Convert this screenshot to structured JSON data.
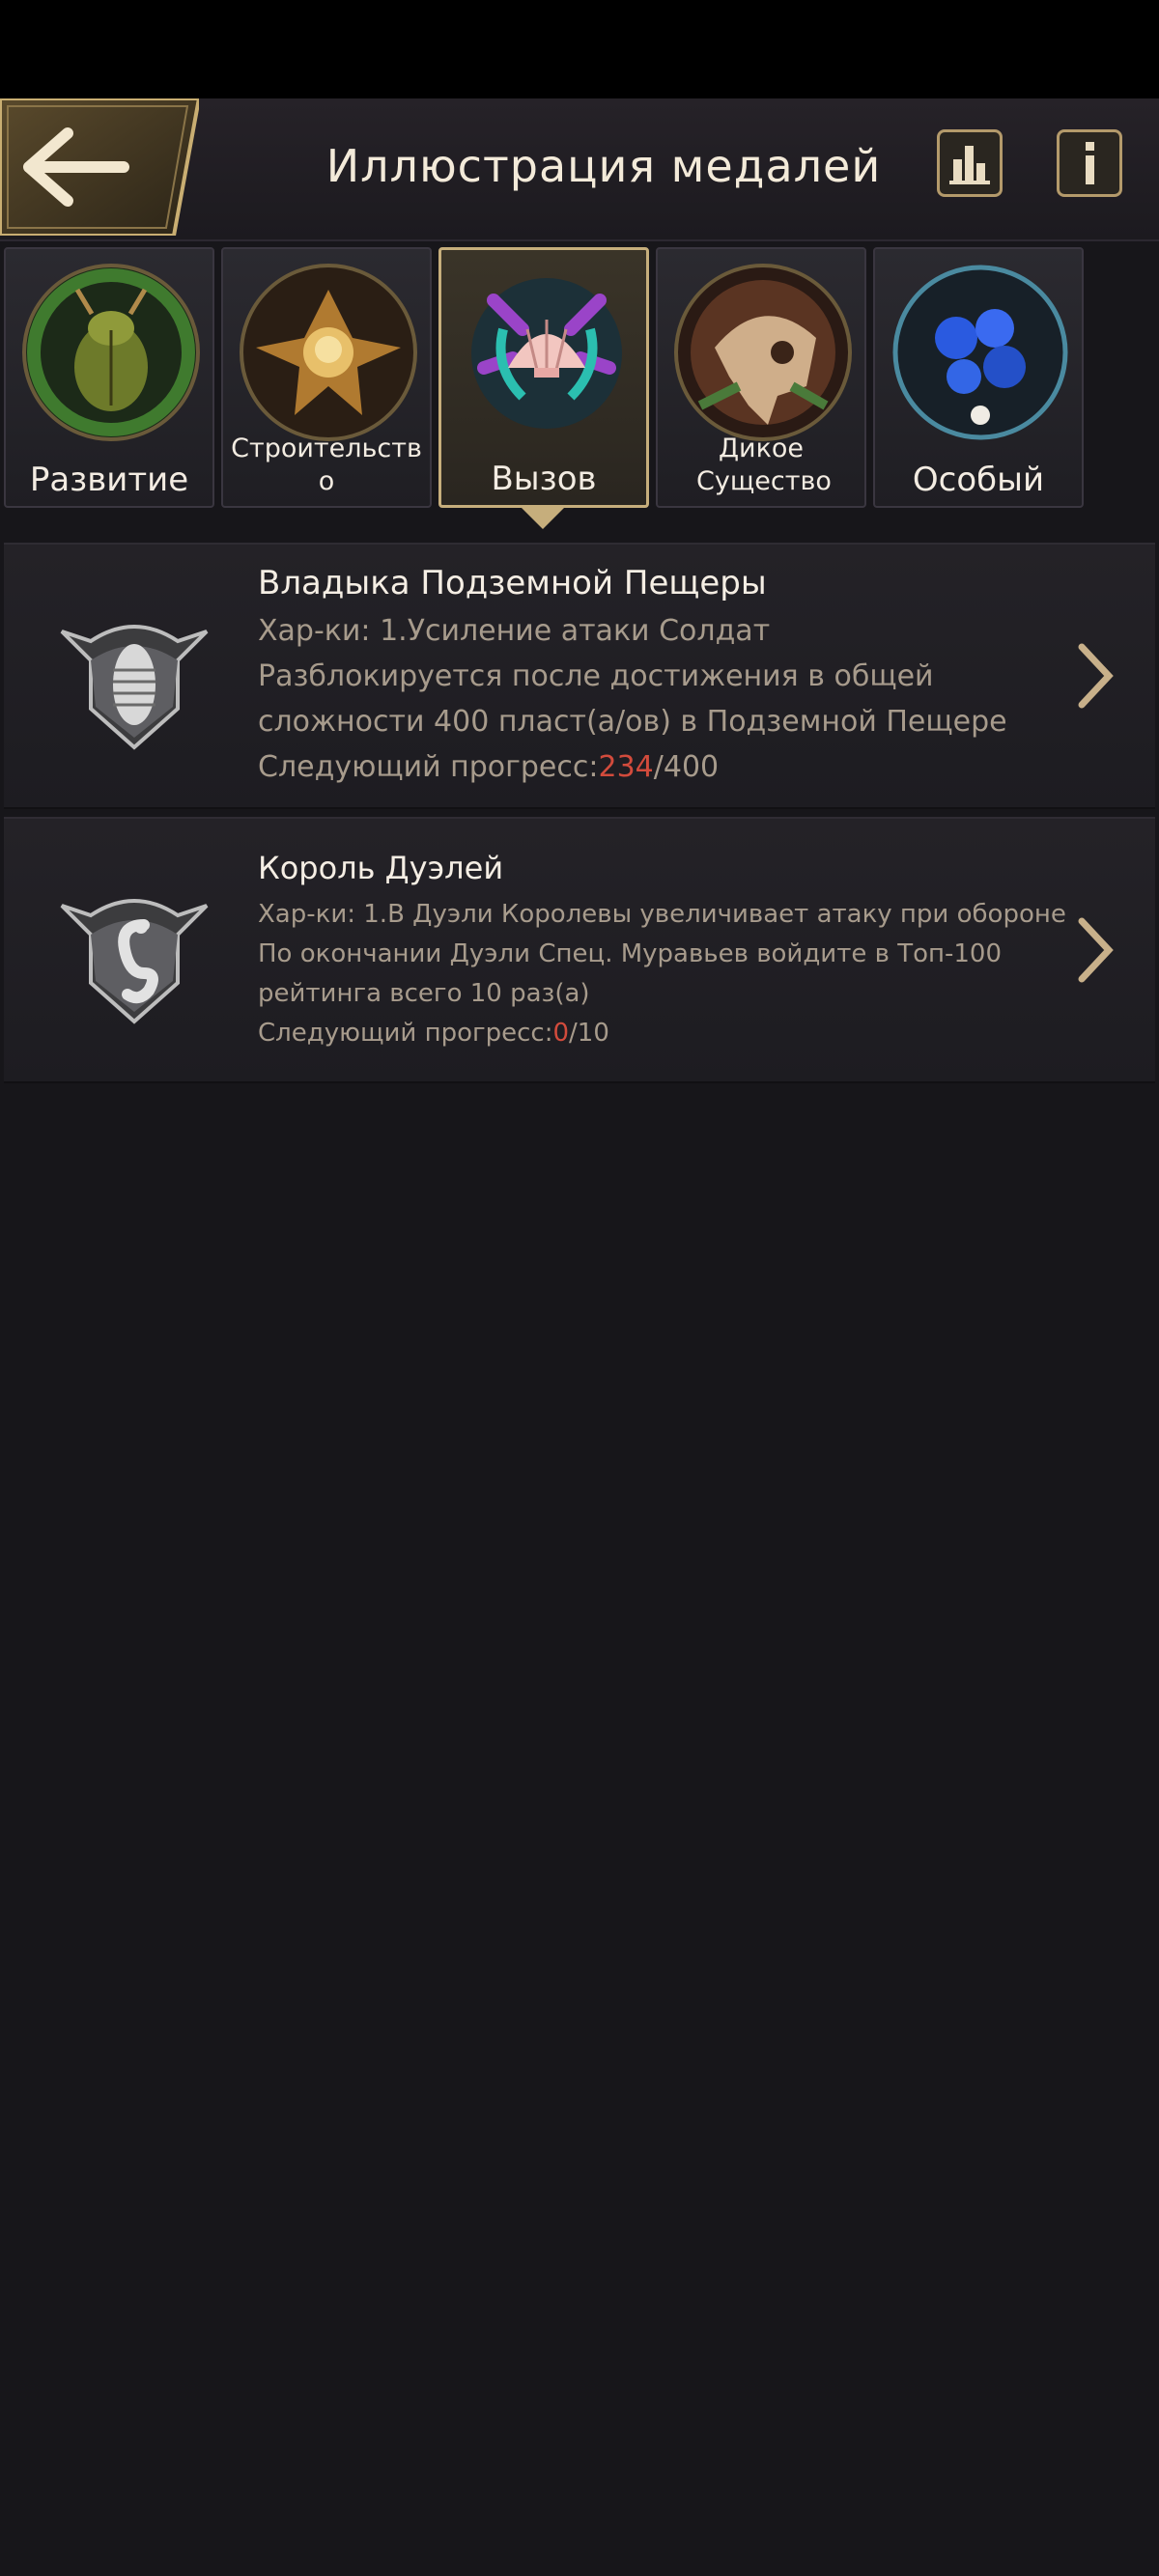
{
  "header": {
    "title": "Иллюстрация медалей"
  },
  "tabs": [
    {
      "label": "Развитие",
      "icon": "beetle-emblem-icon",
      "active": false
    },
    {
      "label": "Строительство",
      "icon": "flower-emblem-icon",
      "active": false
    },
    {
      "label": "Вызов",
      "icon": "shell-emblem-icon",
      "active": true
    },
    {
      "label": "Дикое Существо",
      "icon": "skull-emblem-icon",
      "active": false
    },
    {
      "label": "Особый",
      "icon": "blue-flower-emblem-icon",
      "active": false
    }
  ],
  "medals": [
    {
      "name": "Владыка Подземной Пещеры",
      "stats": "Хар-ки: 1.Усиление атаки Солдат",
      "unlock_line1": "Разблокируется после достижения в общей",
      "unlock_line2": "сложности 400 пласт(а/ов) в Подземной Пещере",
      "progress_label": "Следующий прогресс:",
      "progress_current": "234",
      "progress_total": "/400",
      "icon": "trilobite-shield-icon"
    },
    {
      "name": "Король Дуэлей",
      "stats": "Хар-ки: 1.В Дуэли Королевы увеличивает атаку при обороне",
      "unlock_line1": "По окончании Дуэли Спец. Муравьев войдите в Топ-100",
      "unlock_line2": "рейтинга всего 10 раз(а)",
      "progress_label": "Следующий прогресс:",
      "progress_current": "0",
      "progress_total": "/10",
      "icon": "seahorse-shield-icon"
    }
  ],
  "colors": {
    "accent_gold": "#c6ae7c",
    "progress_red": "#d24b3c",
    "background": "#17161a"
  }
}
